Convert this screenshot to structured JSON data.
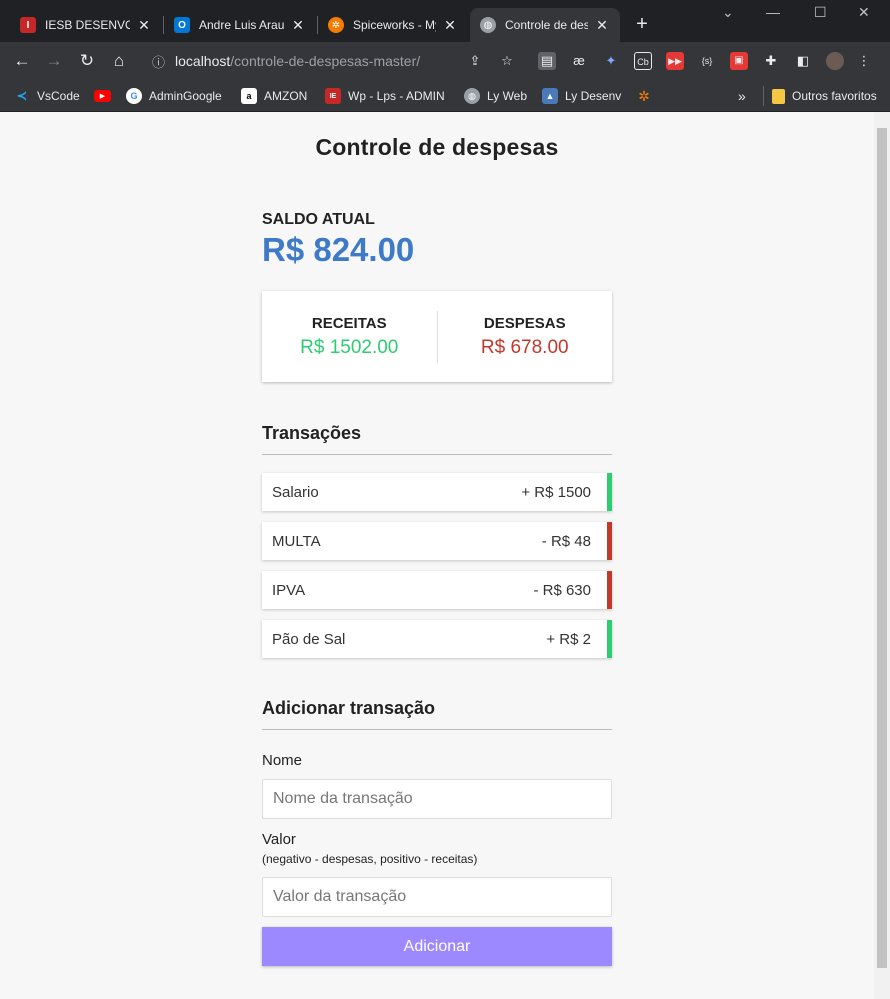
{
  "browser": {
    "tabs": [
      {
        "label": "IESB DESENVOLVI",
        "favicon_color": "#c62828"
      },
      {
        "label": "Andre Luis Arauj",
        "favicon_color": "#0078d4"
      },
      {
        "label": "Spiceworks - My",
        "favicon_color": "#f57c00"
      },
      {
        "label": "Controle de desp",
        "favicon_color": "#9aa0a6"
      }
    ],
    "new_tab_label": "+",
    "url_host": "localhost",
    "url_path": "/controle-de-despesas-master/",
    "bookmarks": [
      {
        "label": "VsCode",
        "icon": "vscode-icon",
        "color": "#23a9f2"
      },
      {
        "label": "",
        "icon": "youtube-icon",
        "color": "#ff0000"
      },
      {
        "label": "AdminGoogle",
        "icon": "google-icon",
        "color": "#ffffff"
      },
      {
        "label": "AMZON",
        "icon": "amazon-icon",
        "color": "#ffffff"
      },
      {
        "label": "Wp - Lps - ADMIN",
        "icon": "iesb-icon",
        "color": "#c62828"
      },
      {
        "label": "Ly Web",
        "icon": "globe-icon",
        "color": "#9aa0a6"
      },
      {
        "label": "Ly Desenv",
        "icon": "ly-icon",
        "color": "#4a7ab8"
      },
      {
        "label": "",
        "icon": "spiceworks-icon",
        "color": "#f57c00"
      }
    ],
    "more_bookmarks_label": "»",
    "other_favorites_label": "Outros favoritos"
  },
  "app": {
    "title": "Controle de despesas",
    "balance_label": "SALDO ATUAL",
    "balance_value": "R$ 824.00",
    "income_label": "RECEITAS",
    "income_value": "R$ 1502.00",
    "expense_label": "DESPESAS",
    "expense_value": "R$ 678.00",
    "transactions_title": "Transações",
    "transactions": [
      {
        "name": "Salario",
        "amount": "+ R$ 1500",
        "kind": "plus"
      },
      {
        "name": "MULTA",
        "amount": "- R$ 48",
        "kind": "minus"
      },
      {
        "name": "IPVA",
        "amount": "- R$ 630",
        "kind": "minus"
      },
      {
        "name": "Pão de Sal",
        "amount": "+ R$ 2",
        "kind": "plus"
      }
    ],
    "add_title": "Adicionar transação",
    "name_label": "Nome",
    "name_placeholder": "Nome da transação",
    "value_label": "Valor",
    "value_hint": "(negativo - despesas, positivo - receitas)",
    "value_placeholder": "Valor da transação",
    "add_button": "Adicionar"
  },
  "colors": {
    "accent_blue": "#3d7ac7",
    "income_green": "#2ecc71",
    "expense_red": "#c0392b",
    "button_purple": "#9c88ff"
  }
}
